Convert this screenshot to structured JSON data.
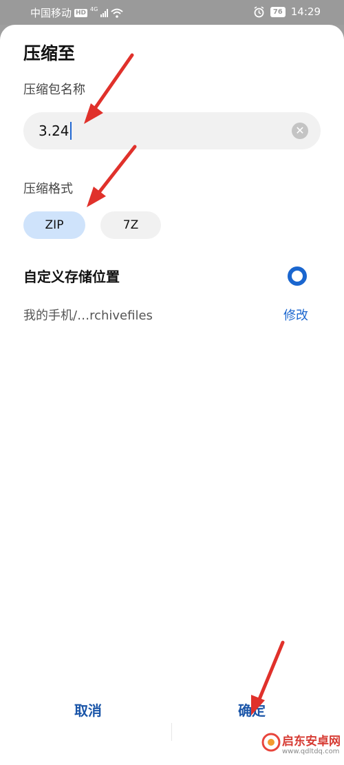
{
  "status_bar": {
    "carrier": "中国移动",
    "hd_badge": "HD",
    "network": "4G",
    "battery": "76",
    "time": "14:29"
  },
  "dialog": {
    "title": "压缩至",
    "name_label": "压缩包名称",
    "name_value": "3.24",
    "format_label": "压缩格式",
    "formats": [
      {
        "label": "ZIP",
        "selected": true
      },
      {
        "label": "7Z",
        "selected": false
      }
    ],
    "custom_location_label": "自定义存储位置",
    "custom_location_enabled": true,
    "path": "我的手机/…rchivefiles",
    "modify_label": "修改",
    "cancel_label": "取消",
    "confirm_label": "确定"
  },
  "watermark": {
    "brand": "启东安卓网",
    "url": "www.qdltdq.com"
  },
  "colors": {
    "accent": "#1a66cf",
    "annotation_arrow": "#e0312b",
    "chip_selected": "#cfe3fb"
  }
}
